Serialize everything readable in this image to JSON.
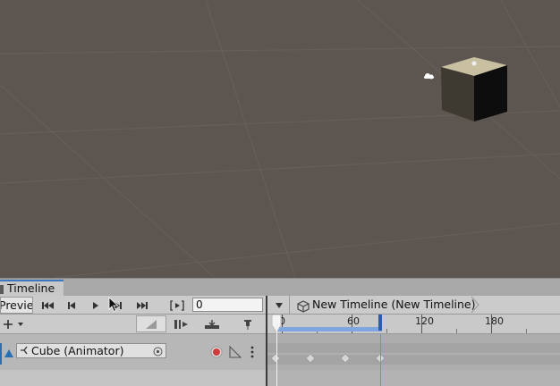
{
  "window": {
    "tab_label": "Timeline"
  },
  "toolbar": {
    "preview_label": "Preview",
    "frame_value": "0",
    "buttons": {
      "first_icon": "skip-to-start-icon",
      "prev_icon": "previous-frame-icon",
      "play_icon": "play-icon",
      "next_icon": "next-frame-icon",
      "last_icon": "skip-to-end-icon",
      "range_icon": "play-range-icon"
    }
  },
  "header": {
    "timeline_name": "New Timeline (New Timeline)"
  },
  "ruler": {
    "labels": [
      "0",
      "60",
      "120",
      "180"
    ],
    "playhead_frame": 0,
    "marker_frame": 67
  },
  "track": {
    "binding_label": "Cube (Animator)",
    "keyframes": [
      0,
      20,
      40,
      60
    ]
  },
  "colors": {
    "scene_background": "#5d5550",
    "accent": "#3a79bb",
    "record": "#d03b3b"
  }
}
